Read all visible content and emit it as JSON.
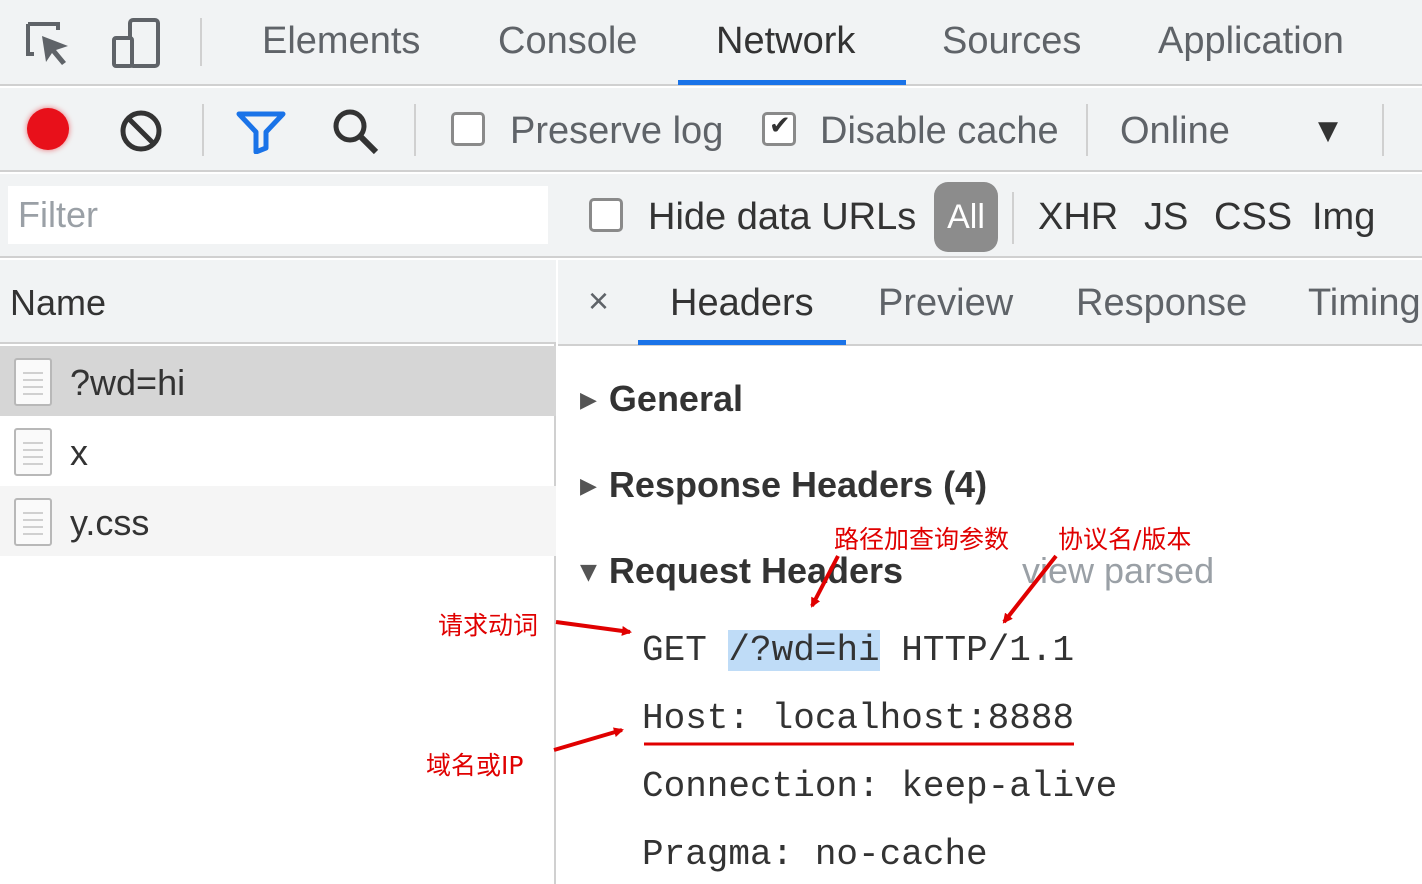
{
  "devtools": {
    "tabs": [
      "Elements",
      "Console",
      "Network",
      "Sources",
      "Application"
    ],
    "active_tab": "Network",
    "toolbar": {
      "preserve_log": "Preserve log",
      "preserve_log_checked": false,
      "disable_cache": "Disable cache",
      "disable_cache_checked": true,
      "throttling": "Online"
    },
    "filter": {
      "placeholder": "Filter",
      "hide_data_urls": "Hide data URLs",
      "types": [
        "All",
        "XHR",
        "JS",
        "CSS",
        "Img"
      ]
    },
    "requests": {
      "column_header": "Name",
      "items": [
        "?wd=hi",
        "x",
        "y.css"
      ]
    },
    "detail": {
      "close": "×",
      "tabs": [
        "Headers",
        "Preview",
        "Response",
        "Timing"
      ],
      "active_tab": "Headers",
      "sections": {
        "general": "General",
        "response_headers": "Response Headers (4)",
        "request_headers": "Request Headers",
        "view_parsed": "view parsed"
      },
      "request_line": {
        "method": "GET",
        "path": "/?wd=hi",
        "protocol": "HTTP/1.1"
      },
      "headers": [
        "Host: localhost:8888",
        "Connection: keep-alive",
        "Pragma: no-cache"
      ]
    }
  },
  "annotations": {
    "verb": "请求动词",
    "path": "路径加查询参数",
    "protocol": "协议名/版本",
    "host": "域名或IP",
    "color": "#e00000"
  },
  "colors": {
    "accent": "#1a73e8",
    "record": "#e8101a",
    "highlight": "#bfdcf7"
  }
}
